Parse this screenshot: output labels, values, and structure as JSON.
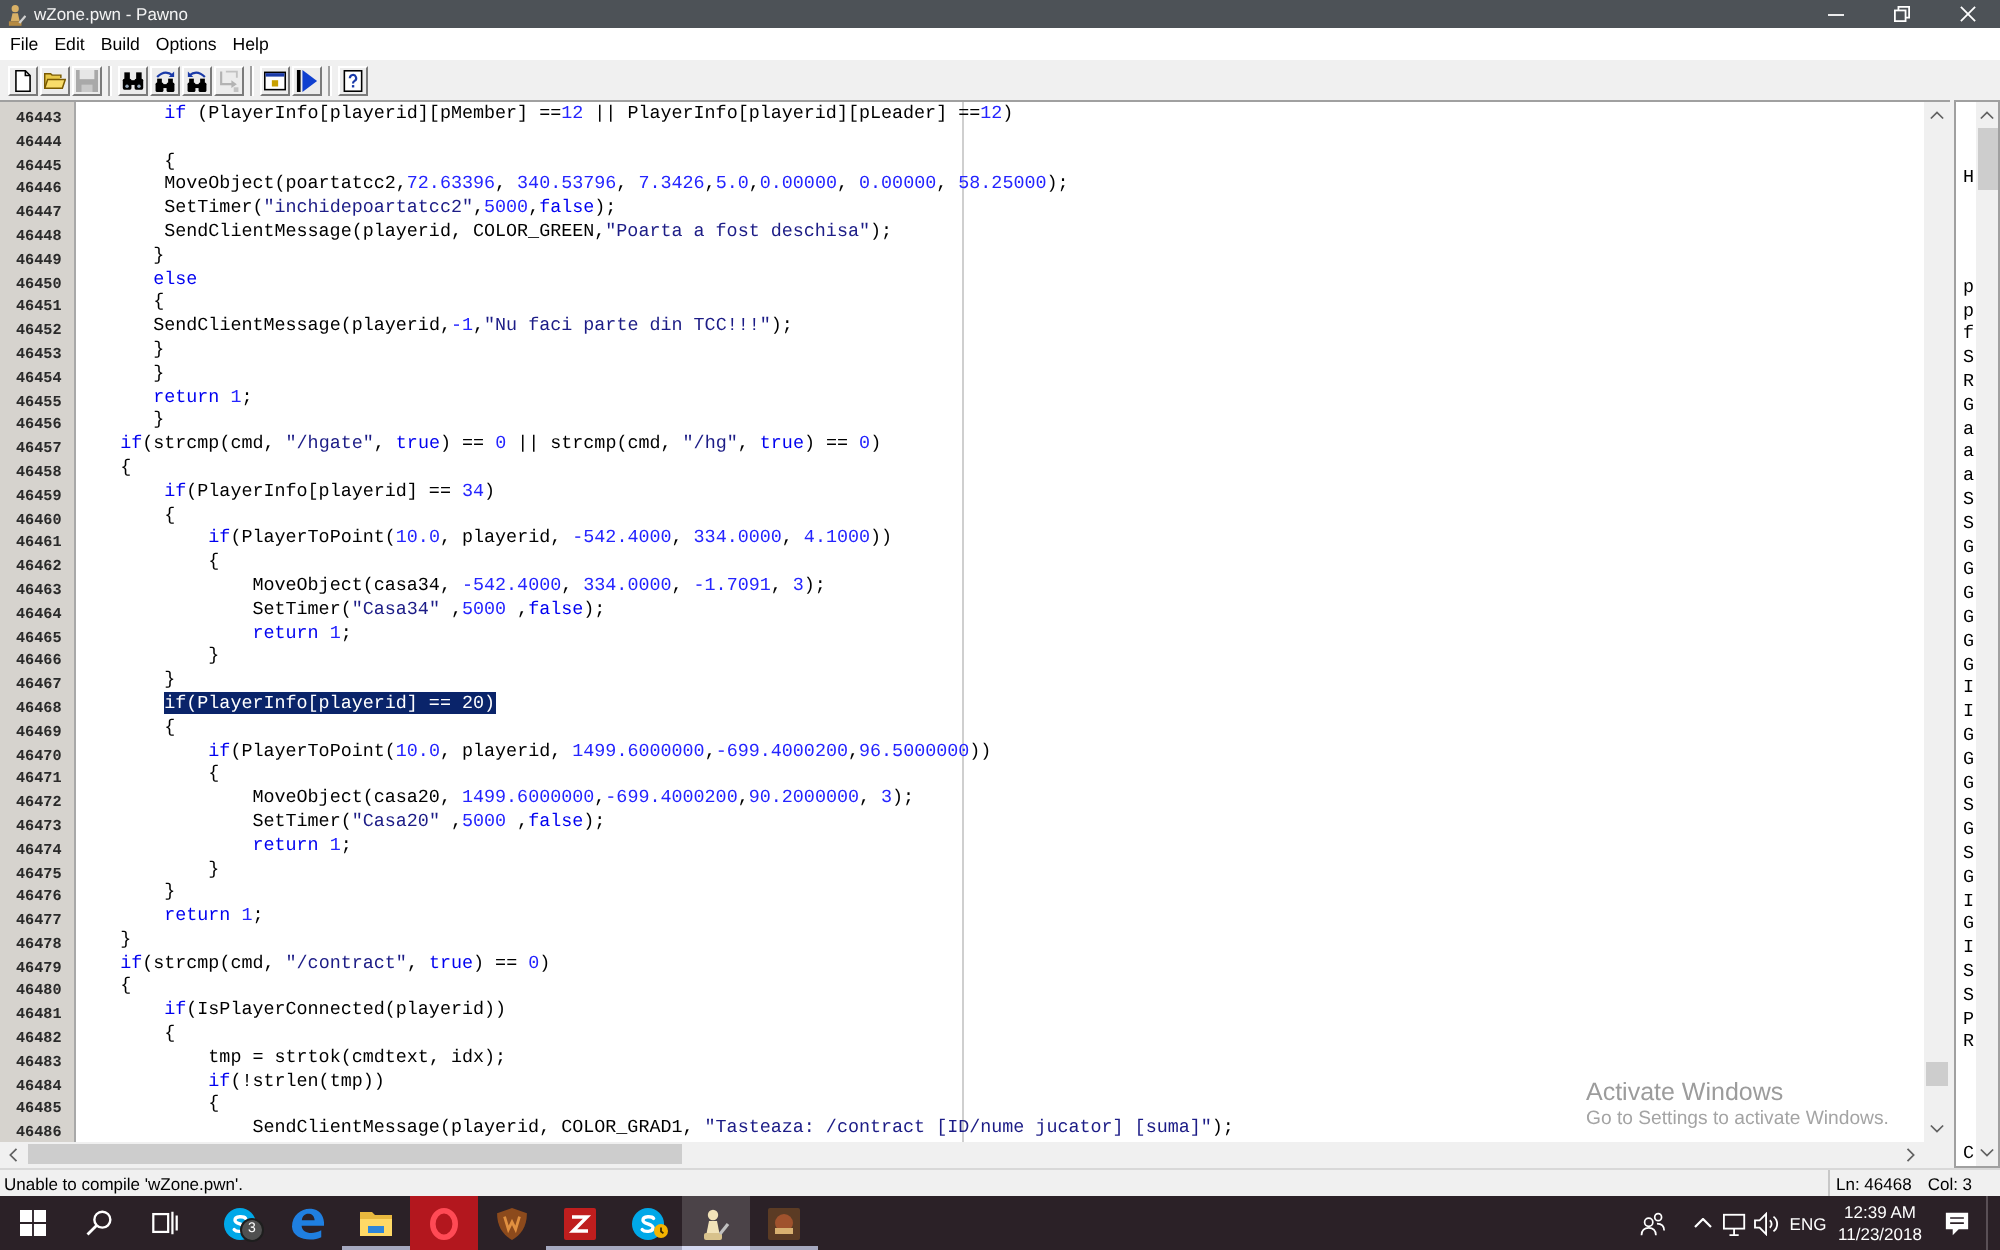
{
  "window": {
    "title": "wZone.pwn - Pawno"
  },
  "menu": [
    "File",
    "Edit",
    "Build",
    "Options",
    "Help"
  ],
  "toolbar": {
    "groups": [
      [
        {
          "kind": "new",
          "disabled": false
        },
        {
          "kind": "open",
          "disabled": false
        },
        {
          "kind": "save",
          "disabled": true
        }
      ],
      [
        {
          "kind": "find",
          "disabled": false
        },
        {
          "kind": "find-next",
          "disabled": false
        },
        {
          "kind": "replace",
          "disabled": false
        },
        {
          "kind": "goto",
          "disabled": true
        }
      ],
      [
        {
          "kind": "window",
          "disabled": false
        },
        {
          "kind": "run",
          "disabled": false
        }
      ],
      [
        {
          "kind": "help",
          "disabled": false
        }
      ]
    ]
  },
  "editor": {
    "lines": [
      {
        "number": "46443",
        "segments": [
          {
            "kind": "keyword",
            "text": "        if"
          },
          {
            "kind": "plain",
            "text": " (PlayerInfo[playerid][pMember] =="
          },
          {
            "kind": "number",
            "text": "12"
          },
          {
            "kind": "plain",
            "text": " || PlayerInfo[playerid][pLeader] =="
          },
          {
            "kind": "number",
            "text": "12"
          },
          {
            "kind": "plain",
            "text": ")"
          }
        ]
      },
      {
        "number": "46444"
      },
      {
        "number": "46445",
        "segments": [
          {
            "kind": "plain",
            "text": "        {"
          }
        ]
      },
      {
        "number": "46446",
        "segments": [
          {
            "kind": "plain",
            "text": "        MoveObject(poartatcc2,"
          },
          {
            "kind": "number",
            "text": "72.63396"
          },
          {
            "kind": "plain",
            "text": ","
          },
          {
            "kind": "number",
            "text": " 340.53796"
          },
          {
            "kind": "plain",
            "text": ","
          },
          {
            "kind": "number",
            "text": " 7.3426"
          },
          {
            "kind": "plain",
            "text": ","
          },
          {
            "kind": "number",
            "text": "5.0"
          },
          {
            "kind": "plain",
            "text": ","
          },
          {
            "kind": "number",
            "text": "0.00000"
          },
          {
            "kind": "plain",
            "text": ","
          },
          {
            "kind": "number",
            "text": " 0.00000"
          },
          {
            "kind": "plain",
            "text": ","
          },
          {
            "kind": "number",
            "text": " 58.25000"
          },
          {
            "kind": "plain",
            "text": ");"
          }
        ]
      },
      {
        "number": "46447",
        "segments": [
          {
            "kind": "plain",
            "text": "        SetTimer("
          },
          {
            "kind": "string",
            "text": "\"inchidepoartatcc2\""
          },
          {
            "kind": "plain",
            "text": ","
          },
          {
            "kind": "number",
            "text": "5000"
          },
          {
            "kind": "plain",
            "text": ","
          },
          {
            "kind": "keyword",
            "text": "false"
          },
          {
            "kind": "plain",
            "text": ");"
          }
        ]
      },
      {
        "number": "46448",
        "segments": [
          {
            "kind": "plain",
            "text": "        SendClientMessage(playerid, COLOR_GREEN,"
          },
          {
            "kind": "string",
            "text": "\"Poarta a fost deschisa\""
          },
          {
            "kind": "plain",
            "text": ");"
          }
        ]
      },
      {
        "number": "46449",
        "segments": [
          {
            "kind": "plain",
            "text": "       }"
          }
        ]
      },
      {
        "number": "46450",
        "segments": [
          {
            "kind": "keyword",
            "text": "       else"
          }
        ]
      },
      {
        "number": "46451",
        "segments": [
          {
            "kind": "plain",
            "text": "       {"
          }
        ]
      },
      {
        "number": "46452",
        "segments": [
          {
            "kind": "plain",
            "text": "       SendClientMessage(playerid,"
          },
          {
            "kind": "number",
            "text": "-1"
          },
          {
            "kind": "plain",
            "text": ","
          },
          {
            "kind": "string",
            "text": "\"Nu faci parte din TCC!!!\""
          },
          {
            "kind": "plain",
            "text": ");"
          }
        ]
      },
      {
        "number": "46453",
        "segments": [
          {
            "kind": "plain",
            "text": "       }"
          }
        ]
      },
      {
        "number": "46454",
        "segments": [
          {
            "kind": "plain",
            "text": "       }"
          }
        ]
      },
      {
        "number": "46455",
        "segments": [
          {
            "kind": "keyword",
            "text": "       return"
          },
          {
            "kind": "number",
            "text": " 1"
          },
          {
            "kind": "plain",
            "text": ";"
          }
        ]
      },
      {
        "number": "46456",
        "segments": [
          {
            "kind": "plain",
            "text": "       }"
          }
        ]
      },
      {
        "number": "46457",
        "segments": [
          {
            "kind": "keyword",
            "text": "    if"
          },
          {
            "kind": "plain",
            "text": "(strcmp(cmd, "
          },
          {
            "kind": "string",
            "text": "\"/hgate\""
          },
          {
            "kind": "plain",
            "text": ", "
          },
          {
            "kind": "keyword",
            "text": "true"
          },
          {
            "kind": "plain",
            "text": ") == "
          },
          {
            "kind": "number",
            "text": "0"
          },
          {
            "kind": "plain",
            "text": " || strcmp(cmd, "
          },
          {
            "kind": "string",
            "text": "\"/hg\""
          },
          {
            "kind": "plain",
            "text": ", "
          },
          {
            "kind": "keyword",
            "text": "true"
          },
          {
            "kind": "plain",
            "text": ") == "
          },
          {
            "kind": "number",
            "text": "0"
          },
          {
            "kind": "plain",
            "text": ")"
          }
        ]
      },
      {
        "number": "46458",
        "segments": [
          {
            "kind": "plain",
            "text": "    {"
          }
        ]
      },
      {
        "number": "46459",
        "segments": [
          {
            "kind": "keyword",
            "text": "        if"
          },
          {
            "kind": "plain",
            "text": "(PlayerInfo[playerid] == "
          },
          {
            "kind": "number",
            "text": "34"
          },
          {
            "kind": "plain",
            "text": ")"
          }
        ]
      },
      {
        "number": "46460",
        "segments": [
          {
            "kind": "plain",
            "text": "        {"
          }
        ]
      },
      {
        "number": "46461",
        "segments": [
          {
            "kind": "keyword",
            "text": "            if"
          },
          {
            "kind": "plain",
            "text": "(PlayerToPoint("
          },
          {
            "kind": "number",
            "text": "10.0"
          },
          {
            "kind": "plain",
            "text": ", playerid, "
          },
          {
            "kind": "number",
            "text": "-542.4000"
          },
          {
            "kind": "plain",
            "text": ","
          },
          {
            "kind": "number",
            "text": " 334.0000"
          },
          {
            "kind": "plain",
            "text": ","
          },
          {
            "kind": "number",
            "text": " 4.1000"
          },
          {
            "kind": "plain",
            "text": "))"
          }
        ]
      },
      {
        "number": "46462",
        "segments": [
          {
            "kind": "plain",
            "text": "            {"
          }
        ]
      },
      {
        "number": "46463",
        "segments": [
          {
            "kind": "plain",
            "text": "                MoveObject(casa34, "
          },
          {
            "kind": "number",
            "text": "-542.4000"
          },
          {
            "kind": "plain",
            "text": ","
          },
          {
            "kind": "number",
            "text": " 334.0000"
          },
          {
            "kind": "plain",
            "text": ","
          },
          {
            "kind": "number",
            "text": " -1.7091"
          },
          {
            "kind": "plain",
            "text": ","
          },
          {
            "kind": "number",
            "text": " 3"
          },
          {
            "kind": "plain",
            "text": ");"
          }
        ]
      },
      {
        "number": "46464",
        "segments": [
          {
            "kind": "plain",
            "text": "                SetTimer("
          },
          {
            "kind": "string",
            "text": "\"Casa34\""
          },
          {
            "kind": "plain",
            "text": " ,"
          },
          {
            "kind": "number",
            "text": "5000"
          },
          {
            "kind": "plain",
            "text": " ,"
          },
          {
            "kind": "keyword",
            "text": "false"
          },
          {
            "kind": "plain",
            "text": ");"
          }
        ]
      },
      {
        "number": "46465",
        "segments": [
          {
            "kind": "keyword",
            "text": "                return"
          },
          {
            "kind": "number",
            "text": " 1"
          },
          {
            "kind": "plain",
            "text": ";"
          }
        ]
      },
      {
        "number": "46466",
        "segments": [
          {
            "kind": "plain",
            "text": "            }"
          }
        ]
      },
      {
        "number": "46467",
        "segments": [
          {
            "kind": "plain",
            "text": "        }"
          }
        ]
      },
      {
        "number": "46468",
        "segments": [
          {
            "kind": "selection",
            "text": "        if(PlayerInfo[playerid] == 20)"
          }
        ]
      },
      {
        "number": "46469",
        "segments": [
          {
            "kind": "plain",
            "text": "        {"
          }
        ]
      },
      {
        "number": "46470",
        "segments": [
          {
            "kind": "keyword",
            "text": "            if"
          },
          {
            "kind": "plain",
            "text": "(PlayerToPoint("
          },
          {
            "kind": "number",
            "text": "10.0"
          },
          {
            "kind": "plain",
            "text": ", playerid, "
          },
          {
            "kind": "number",
            "text": "1499.6000000"
          },
          {
            "kind": "plain",
            "text": ","
          },
          {
            "kind": "number",
            "text": "-699.4000200"
          },
          {
            "kind": "plain",
            "text": ","
          },
          {
            "kind": "number",
            "text": "96.5000000"
          },
          {
            "kind": "plain",
            "text": "))"
          }
        ]
      },
      {
        "number": "46471",
        "segments": [
          {
            "kind": "plain",
            "text": "            {"
          }
        ]
      },
      {
        "number": "46472",
        "segments": [
          {
            "kind": "plain",
            "text": "                MoveObject(casa20, "
          },
          {
            "kind": "number",
            "text": "1499.6000000"
          },
          {
            "kind": "plain",
            "text": ","
          },
          {
            "kind": "number",
            "text": "-699.4000200"
          },
          {
            "kind": "plain",
            "text": ","
          },
          {
            "kind": "number",
            "text": "90.2000000"
          },
          {
            "kind": "plain",
            "text": ","
          },
          {
            "kind": "number",
            "text": " 3"
          },
          {
            "kind": "plain",
            "text": ");"
          }
        ]
      },
      {
        "number": "46473",
        "segments": [
          {
            "kind": "plain",
            "text": "                SetTimer("
          },
          {
            "kind": "string",
            "text": "\"Casa20\""
          },
          {
            "kind": "plain",
            "text": " ,"
          },
          {
            "kind": "number",
            "text": "5000"
          },
          {
            "kind": "plain",
            "text": " ,"
          },
          {
            "kind": "keyword",
            "text": "false"
          },
          {
            "kind": "plain",
            "text": ");"
          }
        ]
      },
      {
        "number": "46474",
        "segments": [
          {
            "kind": "keyword",
            "text": "                return"
          },
          {
            "kind": "number",
            "text": " 1"
          },
          {
            "kind": "plain",
            "text": ";"
          }
        ]
      },
      {
        "number": "46475",
        "segments": [
          {
            "kind": "plain",
            "text": "            }"
          }
        ]
      },
      {
        "number": "46476",
        "segments": [
          {
            "kind": "plain",
            "text": "        }"
          }
        ]
      },
      {
        "number": "46477",
        "segments": [
          {
            "kind": "keyword",
            "text": "        return"
          },
          {
            "kind": "number",
            "text": " 1"
          },
          {
            "kind": "plain",
            "text": ";"
          }
        ]
      },
      {
        "number": "46478",
        "segments": [
          {
            "kind": "plain",
            "text": "    }"
          }
        ]
      },
      {
        "number": "46479",
        "segments": [
          {
            "kind": "keyword",
            "text": "    if"
          },
          {
            "kind": "plain",
            "text": "(strcmp(cmd, "
          },
          {
            "kind": "string",
            "text": "\"/contract\""
          },
          {
            "kind": "plain",
            "text": ", "
          },
          {
            "kind": "keyword",
            "text": "true"
          },
          {
            "kind": "plain",
            "text": ") == "
          },
          {
            "kind": "number",
            "text": "0"
          },
          {
            "kind": "plain",
            "text": ")"
          }
        ]
      },
      {
        "number": "46480",
        "segments": [
          {
            "kind": "plain",
            "text": "    {"
          }
        ]
      },
      {
        "number": "46481",
        "segments": [
          {
            "kind": "keyword",
            "text": "        if"
          },
          {
            "kind": "plain",
            "text": "(IsPlayerConnected(playerid))"
          }
        ]
      },
      {
        "number": "46482",
        "segments": [
          {
            "kind": "plain",
            "text": "        {"
          }
        ]
      },
      {
        "number": "46483",
        "segments": [
          {
            "kind": "plain",
            "text": "            tmp = strtok(cmdtext, idx);"
          }
        ]
      },
      {
        "number": "46484",
        "segments": [
          {
            "kind": "keyword",
            "text": "            if"
          },
          {
            "kind": "plain",
            "text": "(!strlen(tmp))"
          }
        ]
      },
      {
        "number": "46485",
        "segments": [
          {
            "kind": "plain",
            "text": "            {"
          }
        ]
      },
      {
        "number": "46486",
        "segments": [
          {
            "kind": "plain",
            "text": "                SendClientMessage(playerid, COLOR_GRAD1, "
          },
          {
            "kind": "string",
            "text": "\"Tasteaza: /contract [ID/nume jucator] [suma]\""
          },
          {
            "kind": "plain",
            "text": ");"
          }
        ]
      }
    ]
  },
  "function_list": {
    "items": [
      "H",
      "p",
      "p",
      "f",
      "S",
      "R",
      "G",
      "a",
      "a",
      "a",
      "S",
      "S",
      "G",
      "G",
      "G",
      "G",
      "G",
      "G",
      "I",
      "I",
      "G",
      "G",
      "G",
      "S",
      "G",
      "S",
      "G",
      "I",
      "G",
      "I",
      "S",
      "S",
      "P",
      "R",
      "C"
    ]
  },
  "activation_notice": {
    "title": "Activate Windows",
    "hint": "Go to Settings to activate Windows."
  },
  "status_bar": {
    "message": "Unable to compile 'wZone.pwn'.",
    "line": "Ln: 46468",
    "column": "Col: 3"
  },
  "taskbar": {
    "apps": [
      {
        "kind": "chat",
        "badge": "3",
        "running": false,
        "selected": false,
        "alert": false
      },
      {
        "kind": "browser",
        "running": false,
        "selected": false,
        "alert": false
      },
      {
        "kind": "folder",
        "running": true,
        "selected": false,
        "alert": false
      },
      {
        "kind": "ring",
        "running": false,
        "selected": false,
        "alert": true
      },
      {
        "kind": "shield",
        "running": false,
        "selected": false,
        "alert": false
      },
      {
        "kind": "ftp",
        "running": true,
        "selected": false,
        "alert": false
      },
      {
        "kind": "chat-away",
        "running": true,
        "selected": false,
        "alert": false
      },
      {
        "kind": "pawn",
        "running": true,
        "selected": true,
        "alert": false
      },
      {
        "kind": "game",
        "running": true,
        "selected": false,
        "alert": false
      }
    ],
    "tray": {
      "language": "ENG",
      "time": "12:39 AM",
      "date": "11/23/2018"
    }
  }
}
